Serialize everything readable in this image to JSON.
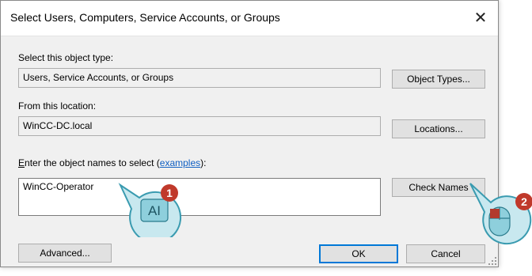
{
  "dialog": {
    "title": "Select Users, Computers, Service Accounts, or Groups",
    "close_glyph": "✕"
  },
  "object_type": {
    "label": "Select this object type:",
    "value": "Users, Service Accounts, or Groups",
    "button": "Object Types..."
  },
  "location": {
    "label": "From this location:",
    "value": "WinCC-DC.local",
    "button": "Locations..."
  },
  "names": {
    "label_prefix_underlined": "E",
    "label_rest": "nter the object names to select (",
    "link": "examples",
    "label_suffix": "):",
    "value": "WinCC-Operator",
    "check_button": "Check Names"
  },
  "footer": {
    "advanced_button": "Advanced...",
    "ok_button": "OK",
    "cancel_button": "Cancel"
  },
  "callouts": [
    {
      "number": "1",
      "icon": "text-cursor-icon",
      "glyph": "AI"
    },
    {
      "number": "2",
      "icon": "mouse-icon"
    }
  ],
  "colors": {
    "badge": "#c0392b",
    "bubble": "#c8e8ef",
    "bubble_outline": "#3a9bb0",
    "link": "#0f5fc2",
    "accent": "#0078d7"
  }
}
